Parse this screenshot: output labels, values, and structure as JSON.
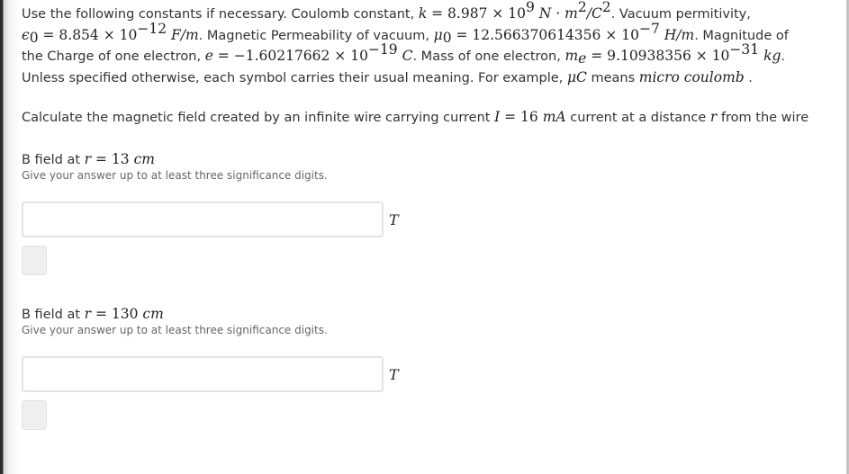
{
  "intro": {
    "t1": "Use the following constants if necessary. Coulomb constant, ",
    "k_sym": "k",
    "k_eq": " = 8.987 × 10",
    "k_exp": "9",
    "k_unit_a": " N · m",
    "k_unit_a_exp": "2",
    "k_unit_b": "/C",
    "k_unit_b_exp": "2",
    "t2": ". Vacuum permitivity,",
    "eps_sym": "ϵ",
    "eps_sub": "0",
    "eps_eq": " = 8.854 × 10",
    "eps_exp": "−12",
    "eps_unit": " F/m",
    "t3": ". Magnetic Permeability of vacuum, ",
    "mu_sym": "μ",
    "mu_sub": "0",
    "mu_eq": " = 12.566370614356 × 10",
    "mu_exp": "−7",
    "mu_unit": " H/m",
    "t4": ". Magnitude of the Charge of one electron, ",
    "e_sym": "e",
    "e_eq": " = −1.60217662 × 10",
    "e_exp": "−19",
    "e_unit": " C",
    "t5": ". Mass of one electron, ",
    "me_sym": "m",
    "me_sub": "e",
    "me_eq": " = 9.10938356 × 10",
    "me_exp": "−31",
    "me_unit": " kg",
    "t6": ". Unless specified otherwise, each symbol carries their usual meaning. For example, ",
    "uc_sym": "μC",
    "t7": " means ",
    "uc_words": "micro coulomb",
    "t8": " ."
  },
  "question": {
    "text_a": "Calculate the magnetic field created by an infinite wire carrying current ",
    "current_sym": "I",
    "current_eq": " = 16 ",
    "current_unit": "mA",
    "text_b": " current at a distance ",
    "r_sym": "r",
    "text_c": " from the wire"
  },
  "parts": [
    {
      "label": "B field at ",
      "r_sym": "r",
      "r_eq": " = 13 ",
      "r_unit": "cm",
      "hint": "Give your answer up to at least three significance digits.",
      "answer_value": "",
      "unit": "T"
    },
    {
      "label": "B field at ",
      "r_sym": "r",
      "r_eq": " = 130 ",
      "r_unit": "cm",
      "hint": "Give your answer up to at least three significance digits.",
      "answer_value": "",
      "unit": "T"
    }
  ]
}
